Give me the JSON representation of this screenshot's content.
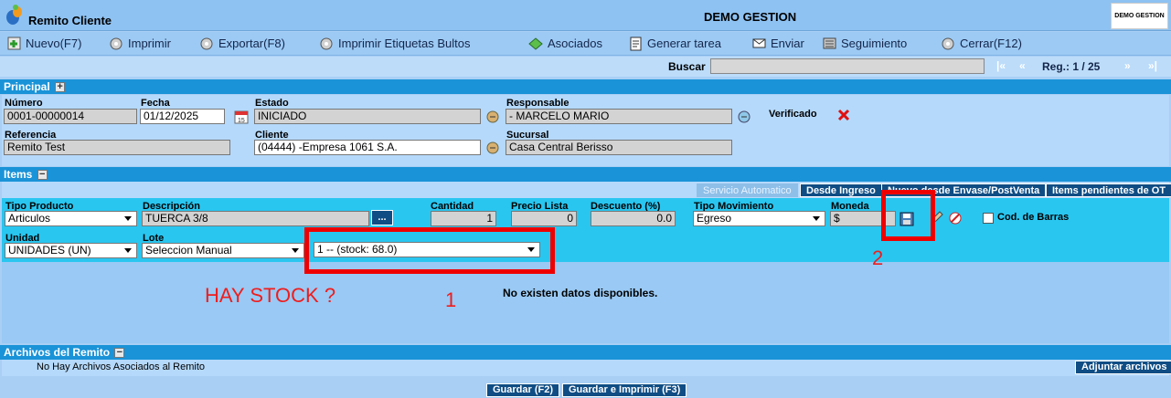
{
  "app": {
    "title": "Remito Cliente",
    "company": "DEMO GESTION",
    "logo_text": "DEMO GESTION"
  },
  "toolbar": {
    "nuevo": "Nuevo(F7)",
    "imprimir": "Imprimir",
    "exportar": "Exportar(F8)",
    "etiquetas": "Imprimir Etiquetas Bultos",
    "asociados": "Asociados",
    "generar_tarea": "Generar tarea",
    "enviar": "Enviar",
    "seguimiento": "Seguimiento",
    "cerrar": "Cerrar(F12)"
  },
  "nav": {
    "buscar_label": "Buscar",
    "buscar_value": "",
    "first": "|«",
    "prev": "«",
    "record": "Reg.: 1 / 25",
    "next": "»",
    "last": "»|"
  },
  "principal": {
    "header": "Principal",
    "numero_label": "Número",
    "numero": "0001-00000014",
    "fecha_label": "Fecha",
    "fecha": "01/12/2025",
    "estado_label": "Estado",
    "estado": "INICIADO",
    "responsable_label": "Responsable",
    "responsable": "- MARCELO MARIO",
    "verificado_label": "Verificado",
    "referencia_label": "Referencia",
    "referencia": "Remito Test",
    "cliente_label": "Cliente",
    "cliente": "(04444) -Empresa 1061 S.A.",
    "sucursal_label": "Sucursal",
    "sucursal": "Casa Central Berisso"
  },
  "items": {
    "header": "Items",
    "tabs": {
      "servicio": "Servicio Automatico",
      "ingreso": "Desde Ingreso",
      "envase": "Nuevo desde Envase/PostVenta",
      "pendientes": "Items pendientes de OT"
    },
    "tipo_producto_label": "Tipo Producto",
    "tipo_producto": "Articulos",
    "descripcion_label": "Descripción",
    "descripcion": "TUERCA 3/8",
    "desc_btn": "...",
    "cantidad_label": "Cantidad",
    "cantidad": "1",
    "precio_label": "Precio Lista",
    "precio": "0",
    "descuento_label": "Descuento (%)",
    "descuento": "0.0",
    "tipo_mov_label": "Tipo Movimiento",
    "tipo_mov": "Egreso",
    "moneda_label": "Moneda",
    "moneda": "$",
    "cod_barras_label": "Cod. de Barras",
    "unidad_label": "Unidad",
    "unidad": "UNIDADES (UN)",
    "lote_label": "Lote",
    "lote": "Seleccion Manual",
    "stock": "1 -- (stock: 68.0)",
    "no_data": "No existen datos disponibles."
  },
  "annotations": {
    "hay_stock": "HAY STOCK ?",
    "num1": "1",
    "num2": "2"
  },
  "archivos": {
    "header": "Archivos del Remito",
    "empty": "No Hay Archivos Asociados al Remito",
    "adjuntar": "Adjuntar archivos"
  },
  "footer": {
    "guardar": "Guardar (F2)",
    "guardar_imprimir": "Guardar e Imprimir (F3)"
  },
  "colors": {
    "section": "#1a93d8",
    "panel": "#b5d9fb",
    "items_row": "#29c6f0",
    "annotation": "#ef0000",
    "button_dark": "#0f4d84"
  }
}
